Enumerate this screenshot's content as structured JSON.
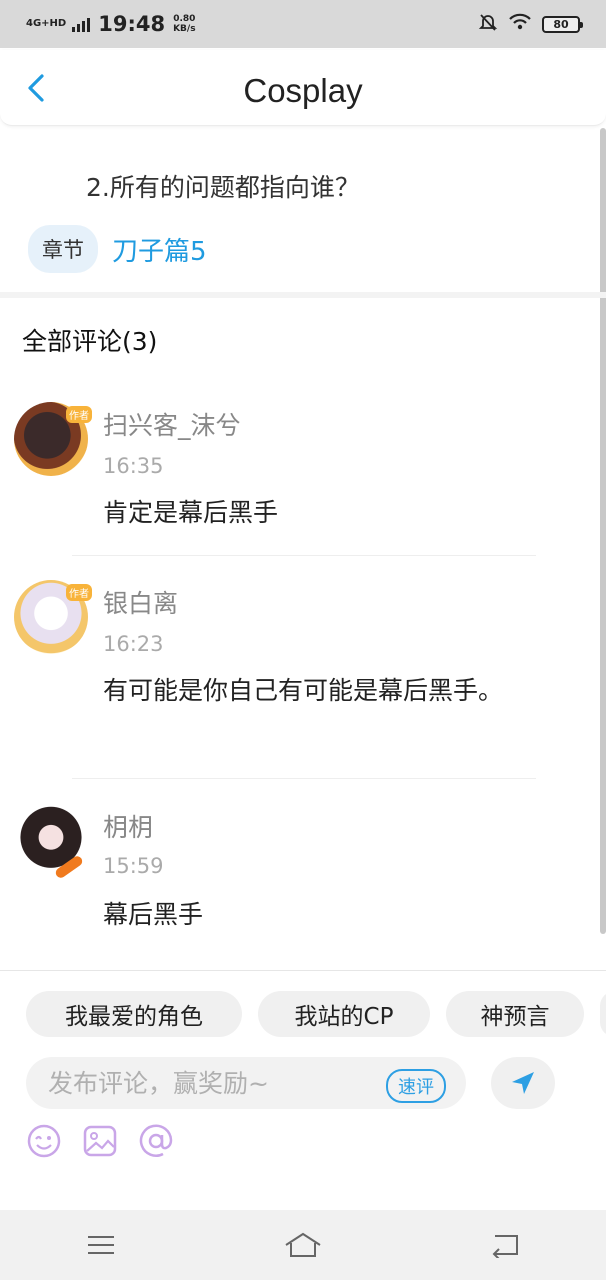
{
  "status_bar": {
    "network": "4G+HD",
    "time": "19:48",
    "speed_value": "0.80",
    "speed_unit": "KB/s",
    "battery": "80"
  },
  "header": {
    "title": "Cosplay",
    "back_icon": "chevron-left-icon",
    "accent_color": "#1f9be0"
  },
  "question": {
    "text": "2.所有的问题都指向谁？",
    "chapter_tag": "章节",
    "chapter_link": "刀子篇5"
  },
  "comments": {
    "heading": "全部评论(3)",
    "items": [
      {
        "user": "扫兴客_沫兮",
        "time": "16:35",
        "text": "肯定是幕后黑手"
      },
      {
        "user": "银白离",
        "time": "16:23",
        "text": "有可能是你自己有可能是幕后黑手。"
      },
      {
        "user": "枂枂",
        "time": "15:59",
        "text": "幕后黑手"
      }
    ]
  },
  "composer": {
    "quick_tags": [
      "我最爱的角色",
      "我站的CP",
      "神预言"
    ],
    "placeholder": "发布评论，赢奖励~",
    "quick_rate": "速评",
    "send_icon": "send-icon",
    "tool_icons": [
      "emoji-icon",
      "image-icon",
      "mention-icon"
    ]
  },
  "navbar": {
    "icons": [
      "menu-icon",
      "home-icon",
      "back-nav-icon"
    ]
  }
}
